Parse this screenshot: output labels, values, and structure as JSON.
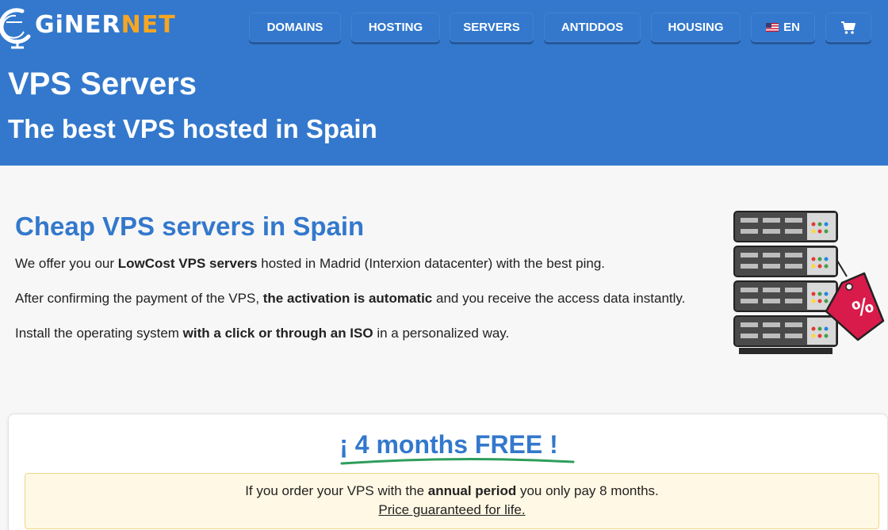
{
  "brand": {
    "logo_prefix": "GiNER",
    "logo_suffix": "NET"
  },
  "nav": {
    "items": [
      "DOMAINS",
      "HOSTING",
      "SERVERS",
      "ANTIDDOS",
      "HOUSING"
    ],
    "language": "EN",
    "cart_icon": "cart-icon"
  },
  "hero": {
    "title": "VPS Servers",
    "subtitle": "The best VPS hosted in Spain"
  },
  "intro": {
    "heading": "Cheap VPS servers in Spain",
    "p1": {
      "pre": "We offer you our ",
      "bold": "LowCost VPS servers",
      "post": " hosted in Madrid (Interxion datacenter) with the best ping."
    },
    "p2": {
      "pre": "After confirming the payment of the VPS, ",
      "bold": "the activation is automatic",
      "post": " and you receive the access data instantly."
    },
    "p3": {
      "pre": "Install the operating system ",
      "bold": "with a click or through an ISO",
      "post": " in a personalized way."
    }
  },
  "promo": {
    "heading": "¡ 4 months FREE !",
    "line1": {
      "pre": "If you order your VPS with the ",
      "bold": "annual period",
      "post": " you only pay 8 months."
    },
    "line2": "Price guaranteed for life."
  },
  "colors": {
    "primary": "#3378cc",
    "accent": "#f6a623",
    "tag": "#d81b4a",
    "notice_bg": "#fff8e4"
  }
}
